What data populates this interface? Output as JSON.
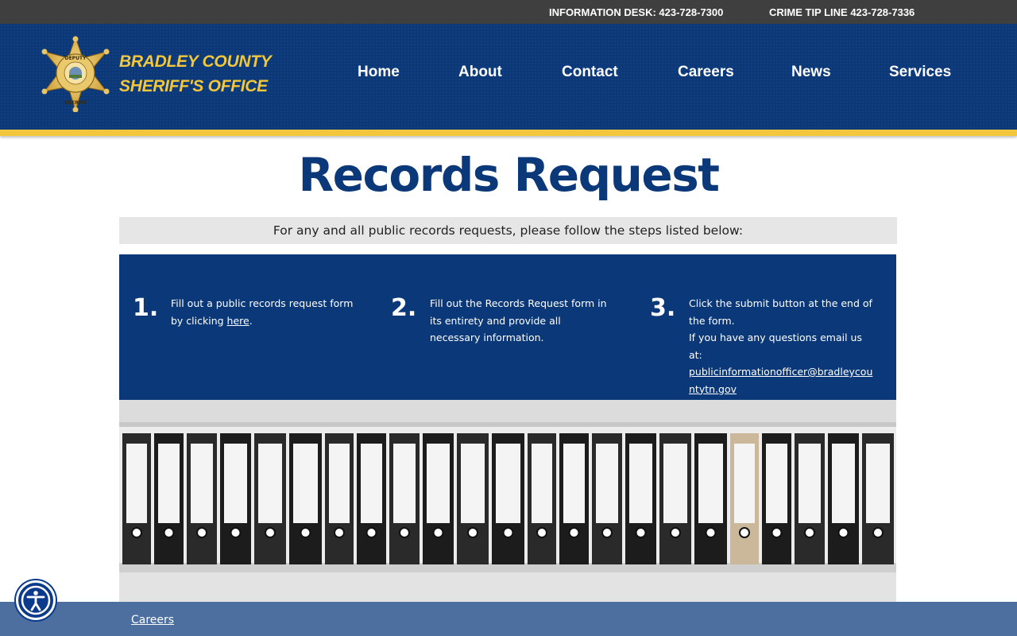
{
  "topbar": {
    "info_desk": "INFORMATION DESK: 423-728-7300",
    "crime_tip": "CRIME TIP LINE 423-728-7336"
  },
  "brand": {
    "line1": "BRADLEY COUNTY",
    "line2": "SHERIFF'S OFFICE",
    "badge_text_top": "DEPUTY",
    "badge_text_bottom": "SHERIFF"
  },
  "nav": {
    "items": [
      {
        "label": "Home"
      },
      {
        "label": "About"
      },
      {
        "label": "Contact"
      },
      {
        "label": "Careers"
      },
      {
        "label": "News"
      },
      {
        "label": "Services"
      }
    ]
  },
  "page": {
    "title": "Records Request",
    "intro": "For any and all public records requests, please follow the steps listed below:"
  },
  "steps": [
    {
      "number": "1.",
      "text_before": "Fill out a public records request form by clicking ",
      "link": "here",
      "text_after": "."
    },
    {
      "number": "2.",
      "text": "Fill out the Records Request form in its entirety and provide all necessary information."
    },
    {
      "number": "3.",
      "text": "Click the submit button at the end of the form.",
      "text2": "If you have any questions email us at:",
      "email": "publicinformationofficer@bradleycountytn.gov"
    }
  ],
  "footer": {
    "link": "Careers"
  },
  "accessibility": {
    "icon": "accessibility-icon"
  },
  "colors": {
    "navy": "#0b3878",
    "gold": "#f2c73b",
    "topbar": "#3f3f3f",
    "footer": "#4c6f9f"
  }
}
